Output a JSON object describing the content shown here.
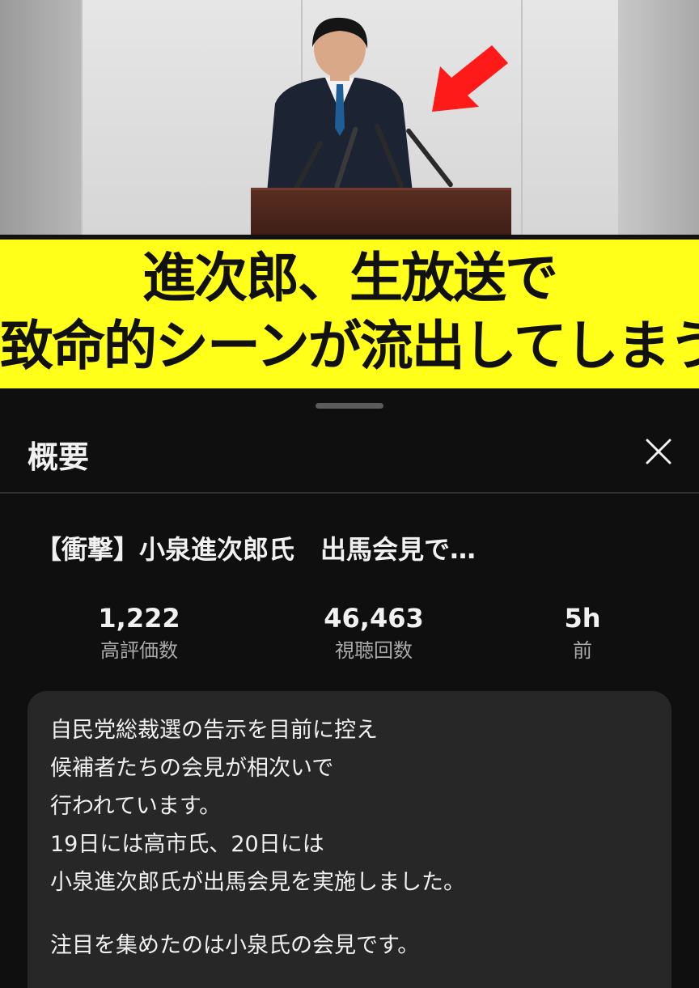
{
  "video": {
    "caption_line1": "進次郎、生放送で",
    "caption_line2": "致命的シーンが流出してしまう"
  },
  "sheet": {
    "title": "概要",
    "video_title": "【衝撃】小泉進次郎氏　出馬会見で…",
    "stats": [
      {
        "value": "1,222",
        "label": "高評価数"
      },
      {
        "value": "46,463",
        "label": "視聴回数"
      },
      {
        "value": "5h",
        "label": "前"
      }
    ],
    "description_lines": [
      "自民党総裁選の告示を目前に控え",
      "候補者たちの会見が相次いで",
      "行われています。",
      "19日には高市氏、20日には",
      "小泉進次郎氏が出馬会見を実施しました。",
      "",
      "注目を集めたのは小泉氏の会見です。"
    ]
  },
  "colors": {
    "banner_yellow": "#ffff1a",
    "arrow_red": "#ff1a1a",
    "sheet_bg": "#0f0f0f",
    "desc_bg": "#272727"
  },
  "icons": {
    "close": "close-icon",
    "arrow": "red-arrow-icon"
  }
}
